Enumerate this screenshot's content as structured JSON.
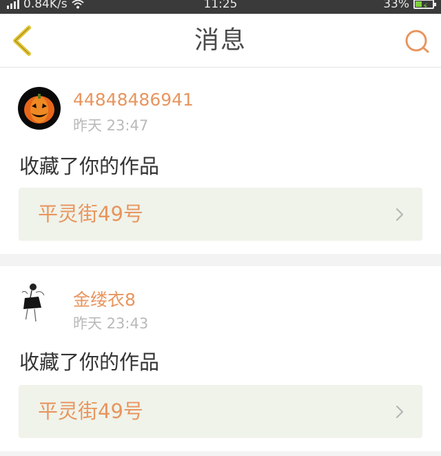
{
  "status_bar": {
    "network_speed": "0.84K/s",
    "time": "11:25",
    "battery": "33%"
  },
  "nav": {
    "title": "消息",
    "back_icon": "chevron-left-icon",
    "search_icon": "search-icon"
  },
  "notifications": [
    {
      "username": "44848486941",
      "time": "昨天 23:47",
      "message": "收藏了你的作品",
      "work_title": "平灵街49号"
    },
    {
      "username": "金缕衣8",
      "time": "昨天 23:43",
      "message": "收藏了你的作品",
      "work_title": "平灵街49号"
    }
  ],
  "colors": {
    "accent": "#e8955e",
    "back_icon": "#e2c531",
    "card_link_bg": "#f0f3ea"
  }
}
